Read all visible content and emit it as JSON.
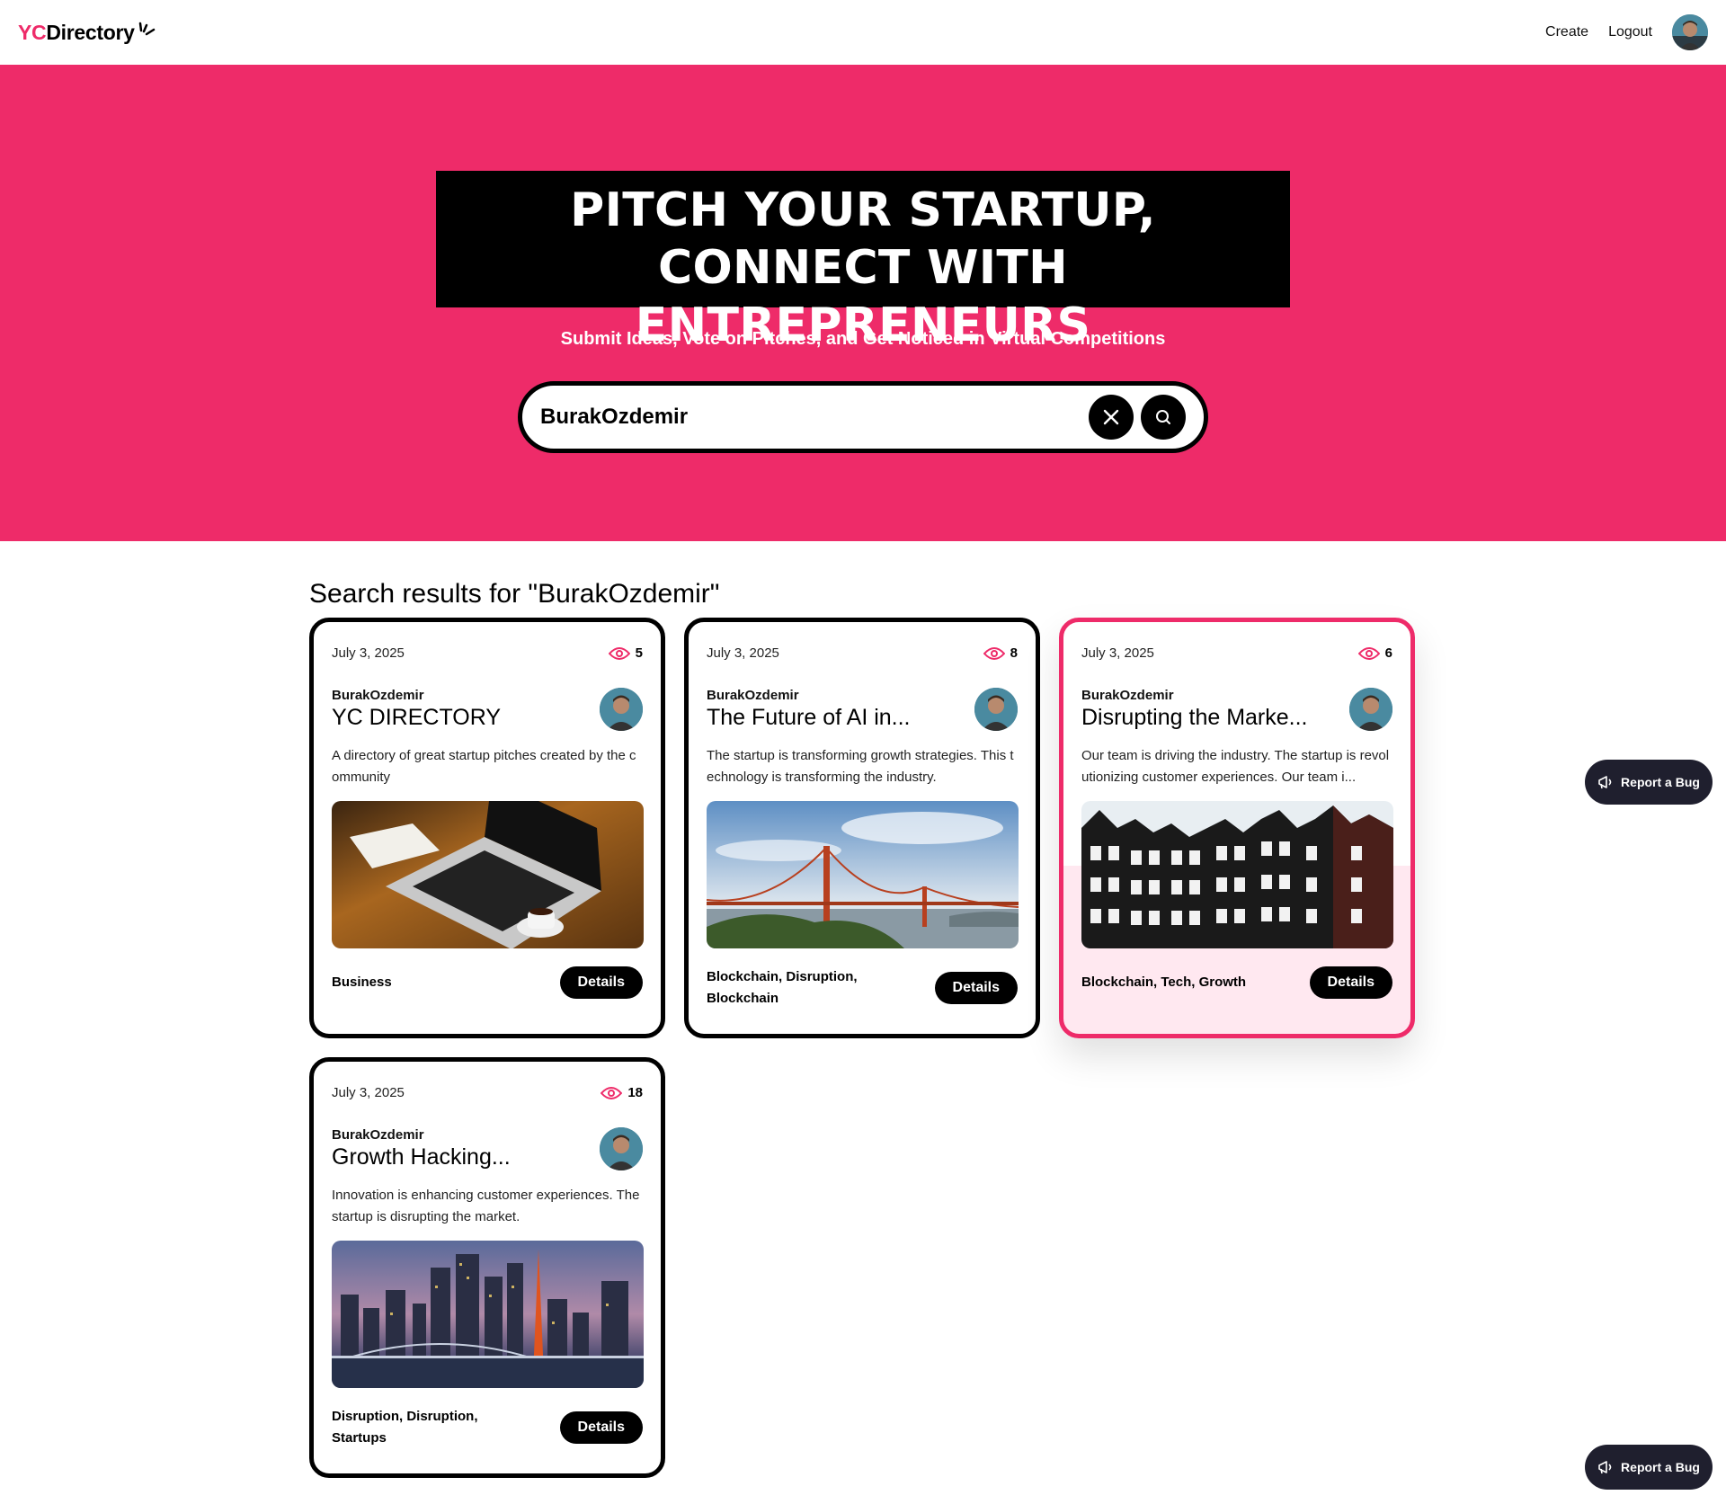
{
  "nav": {
    "logo_yc": "YC",
    "logo_rest": "Directory",
    "create": "Create",
    "logout": "Logout"
  },
  "hero": {
    "title_line1": "PITCH YOUR STARTUP,",
    "title_line2": "CONNECT WITH ENTREPRENEURS",
    "subtitle": "Submit Ideas, Vote on Pitches, and Get Noticed in Virtual Competitions",
    "search_value": "BurakOzdemir"
  },
  "results": {
    "title": "Search results for \"BurakOzdemir\""
  },
  "cards": [
    {
      "date": "July 3, 2025",
      "views": "5",
      "author": "BurakOzdemir",
      "title": "YC DIRECTORY",
      "desc": "A directory of great startup pitches created by the community",
      "category": "Business",
      "details": "Details",
      "image": "laptop"
    },
    {
      "date": "July 3, 2025",
      "views": "8",
      "author": "BurakOzdemir",
      "title": "The Future of AI in...",
      "desc": "The startup is transforming growth strategies. This technology is transforming the industry.",
      "category": "Blockchain, Disruption, Blockchain",
      "details": "Details",
      "image": "bridge"
    },
    {
      "date": "July 3, 2025",
      "views": "6",
      "author": "BurakOzdemir",
      "title": "Disrupting the Marke...",
      "desc": "Our team is driving the industry. The startup is revolutionizing customer experiences. Our team i...",
      "category": "Blockchain, Tech, Growth",
      "details": "Details",
      "image": "houses"
    },
    {
      "date": "July 3, 2025",
      "views": "18",
      "author": "BurakOzdemir",
      "title": "Growth Hacking...",
      "desc": "Innovation is enhancing customer experiences. The startup is disrupting the market.",
      "category": "Disruption, Disruption, Startups",
      "details": "Details",
      "image": "city"
    }
  ],
  "report": {
    "label": "Report a Bug"
  },
  "colors": {
    "brand": "#ee2b69",
    "dark": "#000000",
    "report_bg": "#1f1f2e"
  }
}
